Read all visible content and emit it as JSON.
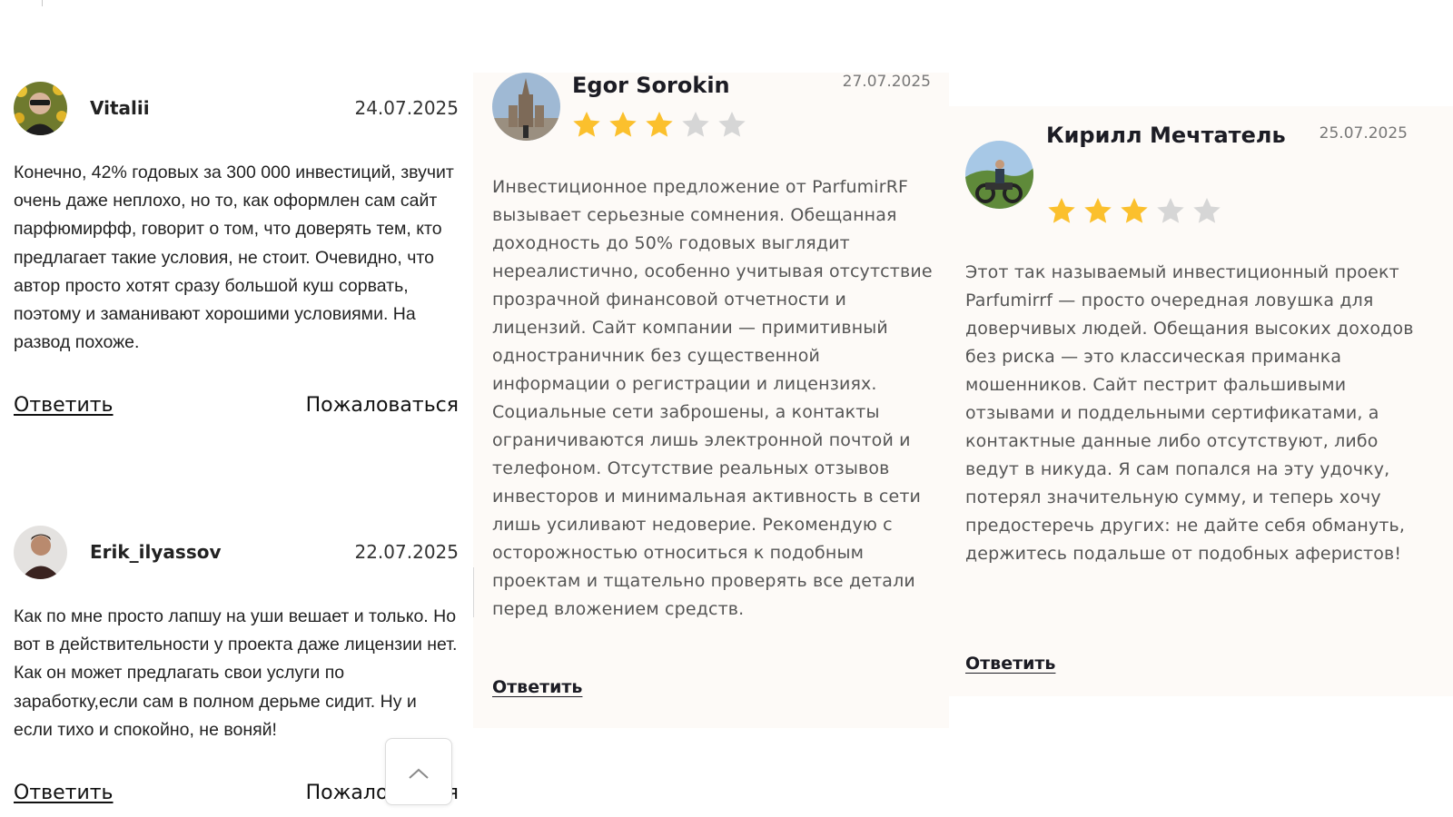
{
  "comments": [
    {
      "name": "Vitalii",
      "date": "24.07.2025",
      "text": "Конечно, 42% годовых за 300 000 инвестиций, звучит очень даже неплохо, но то, как оформлен сам сайт парфюмирфф, говорит о том, что доверять тем, кто предлагает такие условия, не стоит. Очевидно, что автор просто хотят сразу большой куш сорвать, поэтому и заманивают хорошими условиями. На развод похоже.",
      "reply_label": "Ответить",
      "report_label": "Пожаловаться"
    },
    {
      "name": "Erik_ilyassov",
      "date": "22.07.2025",
      "text": "Как по мне просто лапшу на уши вешает и только. Но вот в действительности у проекта даже лицензии нет. Как он может предлагать свои услуги по заработку,если сам в полном дерьме сидит. Ну и если тихо и спокойно, не воняй!",
      "reply_label": "Ответить",
      "report_label": "Пожаловаться"
    }
  ],
  "screenshot_reviews": [
    {
      "name": "Egor Sorokin",
      "date": "27.07.2025",
      "rating": 3,
      "max_rating": 5,
      "text": "Инвестиционное предложение от ParfumirRF вызывает серьезные сомнения. Обещанная доходность до 50% годовых выглядит нереалистично, особенно учитывая отсутствие прозрачной финансовой отчетности и лицензий. Сайт компании — примитивный одностраничник без существенной информации о регистрации и лицензиях. Социальные сети заброшены, а контакты ограничиваются лишь электронной почтой и телефоном. Отсутствие реальных отзывов инвесторов и минимальная активность в сети лишь усиливают недоверие. Рекомендую с осторожностью относиться к подобным проектам и тщательно проверять все детали перед вложением средств.",
      "reply_label": "Ответить"
    },
    {
      "name": "Кирилл Мечтатель",
      "date": "25.07.2025",
      "rating": 3,
      "max_rating": 5,
      "text": "Этот так называемый инвестиционный проект Parfumirrf — просто очередная ловушка для доверчивых людей. Обещания высоких доходов без риска — это классическая приманка мошенников. Сайт пестрит фальшивыми отзывами и поддельными сертификатами, а контактные данные либо отсутствуют, либо ведут в никуда. Я сам попался на эту удочку, потерял значительную сумму, и теперь хочу предостеречь других: не дайте себя обмануть, держитесь подальше от подобных аферистов!",
      "reply_label": "Ответить"
    }
  ],
  "colors": {
    "star_filled": "#fbc02d",
    "star_empty": "#d6d6d6",
    "card_bg": "#fdfaf7"
  },
  "icons": {
    "scroll_top": "chevron-up-icon"
  }
}
